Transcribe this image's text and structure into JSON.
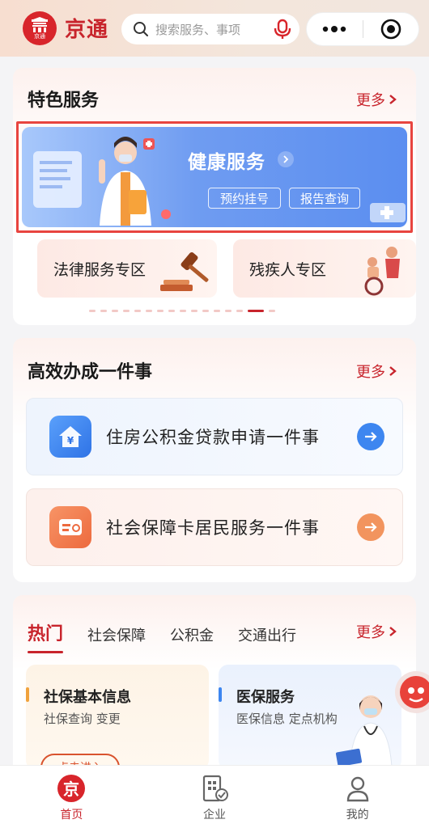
{
  "header": {
    "logo_text": "京通",
    "app_title": "京通",
    "search_placeholder": "搜索服务、事项",
    "menu_icon": "more-dots-icon",
    "close_icon": "target-close-icon"
  },
  "featured": {
    "title": "特色服务",
    "more": "更多",
    "health": {
      "title": "健康服务",
      "buttons": [
        "预约挂号",
        "报告查询"
      ]
    },
    "sub_cards": [
      "法律服务专区",
      "残疾人专区"
    ],
    "carousel": {
      "count": 16,
      "active_index": 14
    }
  },
  "one_thing": {
    "title": "高效办成一件事",
    "more": "更多",
    "items": [
      {
        "label": "住房公积金贷款申请一件事",
        "icon": "house-yuan-icon",
        "color": "#3d86f0"
      },
      {
        "label": "社会保障卡居民服务一件事",
        "icon": "card-icon",
        "color": "#f07a4a"
      }
    ]
  },
  "hot": {
    "tabs": [
      "热门",
      "社会保障",
      "公积金",
      "交通出行"
    ],
    "active_tab": "热门",
    "more": "更多",
    "cards": [
      {
        "title": "社保基本信息",
        "desc": "社保查询 变更",
        "bar_color": "#f0a23c",
        "button": "点击进入"
      },
      {
        "title": "医保服务",
        "desc": "医保信息 定点机构",
        "bar_color": "#3d86f0"
      }
    ]
  },
  "tabbar": {
    "items": [
      {
        "label": "首页",
        "icon": "home-jing-icon",
        "active": true
      },
      {
        "label": "企业",
        "icon": "enterprise-icon",
        "active": false
      },
      {
        "label": "我的",
        "icon": "profile-icon",
        "active": false
      }
    ]
  },
  "colors": {
    "brand": "#c8242c",
    "blue": "#5b8ef0",
    "orange": "#f07a4a"
  }
}
